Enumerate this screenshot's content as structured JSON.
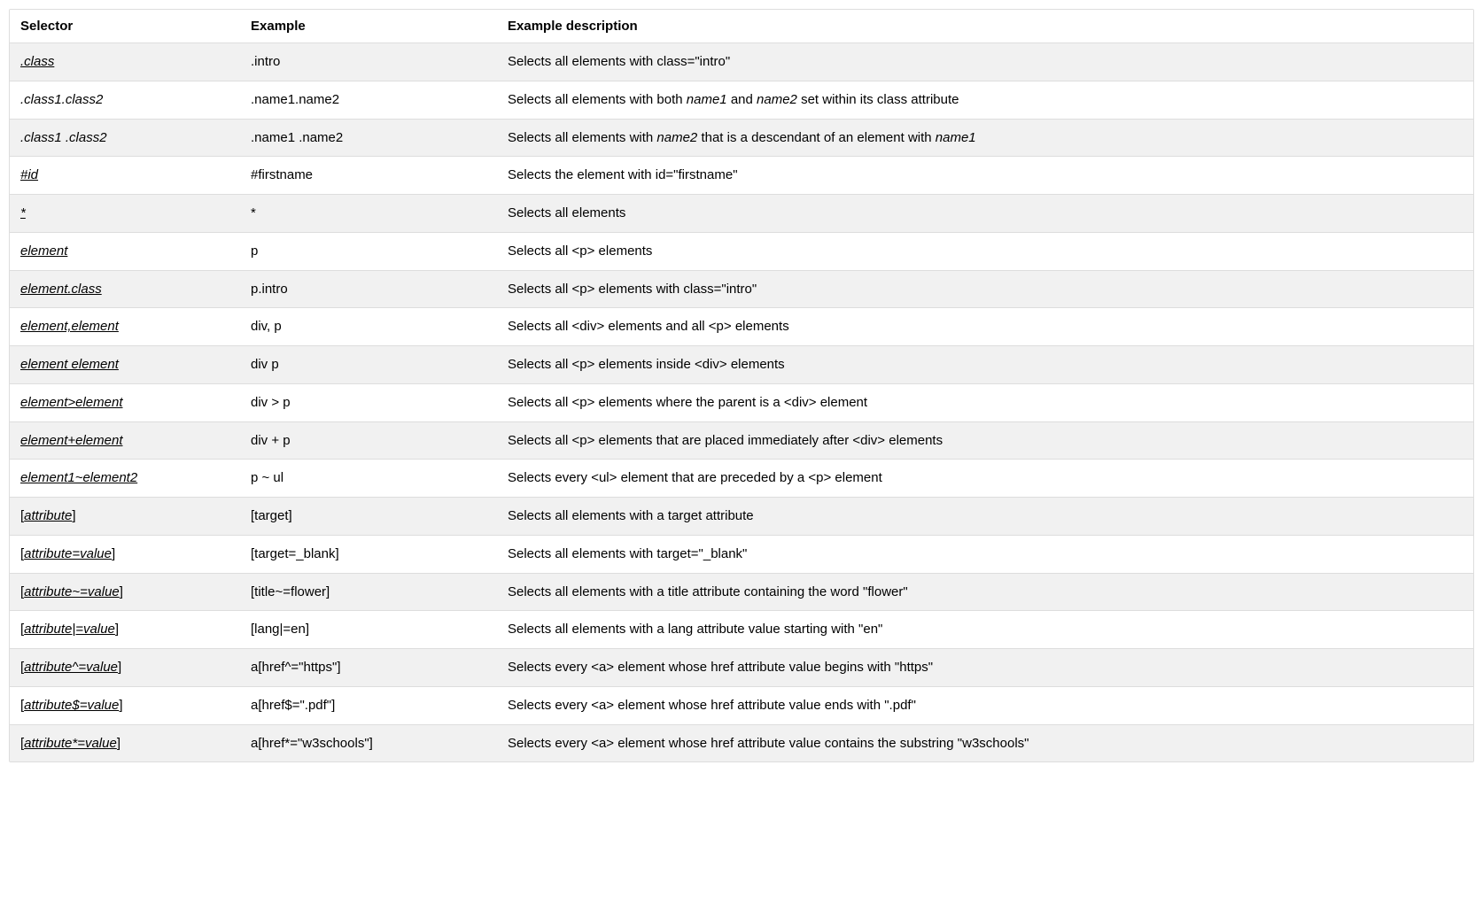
{
  "table": {
    "headers": [
      "Selector",
      "Example",
      "Example description"
    ],
    "rows": [
      {
        "selector_parts": [
          {
            "text": ".class",
            "link": true
          }
        ],
        "example": ".intro",
        "desc_parts": [
          {
            "text": "Selects all elements with class=\"intro\""
          }
        ]
      },
      {
        "selector_parts": [
          {
            "text": ".class1.class2",
            "nolink": true
          }
        ],
        "example": ".name1.name2",
        "desc_parts": [
          {
            "text": "Selects all elements with both "
          },
          {
            "text": "name1",
            "em": true
          },
          {
            "text": " and "
          },
          {
            "text": "name2",
            "em": true
          },
          {
            "text": " set within its class attribute"
          }
        ]
      },
      {
        "selector_parts": [
          {
            "text": ".class1 .class2",
            "nolink": true
          }
        ],
        "example": ".name1 .name2",
        "desc_parts": [
          {
            "text": "Selects all elements with "
          },
          {
            "text": "name2",
            "em": true
          },
          {
            "text": " that is a descendant of an element with "
          },
          {
            "text": "name1",
            "em": true
          }
        ]
      },
      {
        "selector_parts": [
          {
            "text": "#id",
            "link": true
          }
        ],
        "example": "#firstname",
        "desc_parts": [
          {
            "text": "Selects the element with id=\"firstname\""
          }
        ]
      },
      {
        "selector_parts": [
          {
            "text": "*",
            "link": true
          }
        ],
        "example": "*",
        "desc_parts": [
          {
            "text": "Selects all elements"
          }
        ]
      },
      {
        "selector_parts": [
          {
            "text": "element",
            "link": true
          }
        ],
        "example": "p",
        "desc_parts": [
          {
            "text": "Selects all <p> elements"
          }
        ]
      },
      {
        "selector_parts": [
          {
            "text": "element.class",
            "link": true
          }
        ],
        "example": "p.intro",
        "desc_parts": [
          {
            "text": "Selects all <p> elements with class=\"intro\""
          }
        ]
      },
      {
        "selector_parts": [
          {
            "text": "element,element",
            "link": true
          }
        ],
        "example": "div, p",
        "desc_parts": [
          {
            "text": "Selects all <div> elements and all <p> elements"
          }
        ]
      },
      {
        "selector_parts": [
          {
            "text": "element element",
            "link": true
          }
        ],
        "example": "div p",
        "desc_parts": [
          {
            "text": "Selects all <p> elements inside <div> elements"
          }
        ]
      },
      {
        "selector_parts": [
          {
            "text": "element>element",
            "link": true
          }
        ],
        "example": "div > p",
        "desc_parts": [
          {
            "text": "Selects all <p> elements where the parent is a <div> element"
          }
        ]
      },
      {
        "selector_parts": [
          {
            "text": "element+element",
            "link": true
          }
        ],
        "example": "div + p",
        "desc_parts": [
          {
            "text": "Selects all <p> elements that are placed immediately after <div> elements"
          }
        ]
      },
      {
        "selector_parts": [
          {
            "text": "element1~element2",
            "link": true
          }
        ],
        "example": "p ~ ul",
        "desc_parts": [
          {
            "text": "Selects every <ul> element that are preceded by a <p> element"
          }
        ]
      },
      {
        "selector_parts": [
          {
            "text": "[",
            "plain": true
          },
          {
            "text": "attribute",
            "link": true
          },
          {
            "text": "]",
            "plain": true
          }
        ],
        "example": "[target]",
        "desc_parts": [
          {
            "text": "Selects all elements with a target attribute"
          }
        ]
      },
      {
        "selector_parts": [
          {
            "text": "[",
            "plain": true
          },
          {
            "text": "attribute=value",
            "link": true
          },
          {
            "text": "]",
            "plain": true
          }
        ],
        "example": "[target=_blank]",
        "desc_parts": [
          {
            "text": "Selects all elements with target=\"_blank\""
          }
        ]
      },
      {
        "selector_parts": [
          {
            "text": "[",
            "plain": true
          },
          {
            "text": "attribute~=value",
            "link": true
          },
          {
            "text": "]",
            "plain": true
          }
        ],
        "example": "[title~=flower]",
        "desc_parts": [
          {
            "text": "Selects all elements with a title attribute containing the word \"flower\""
          }
        ]
      },
      {
        "selector_parts": [
          {
            "text": "[",
            "plain": true
          },
          {
            "text": "attribute|=value",
            "link": true
          },
          {
            "text": "]",
            "plain": true
          }
        ],
        "example": "[lang|=en]",
        "desc_parts": [
          {
            "text": "Selects all elements with a lang attribute value starting with \"en\""
          }
        ]
      },
      {
        "selector_parts": [
          {
            "text": "[",
            "plain": true
          },
          {
            "text": "attribute^=value",
            "link": true
          },
          {
            "text": "]",
            "plain": true
          }
        ],
        "example": "a[href^=\"https\"]",
        "desc_parts": [
          {
            "text": "Selects every <a> element whose href attribute value begins with \"https\""
          }
        ]
      },
      {
        "selector_parts": [
          {
            "text": "[",
            "plain": true
          },
          {
            "text": "attribute$=value",
            "link": true
          },
          {
            "text": "]",
            "plain": true
          }
        ],
        "example": "a[href$=\".pdf\"]",
        "desc_parts": [
          {
            "text": "Selects every <a> element whose href attribute value ends with \".pdf\""
          }
        ]
      },
      {
        "selector_parts": [
          {
            "text": "[",
            "plain": true
          },
          {
            "text": "attribute*=value",
            "link": true
          },
          {
            "text": "]",
            "plain": true
          }
        ],
        "example": "a[href*=\"w3schools\"]",
        "desc_parts": [
          {
            "text": "Selects every <a> element whose href attribute value contains the substring \"w3schools\""
          }
        ]
      }
    ]
  }
}
